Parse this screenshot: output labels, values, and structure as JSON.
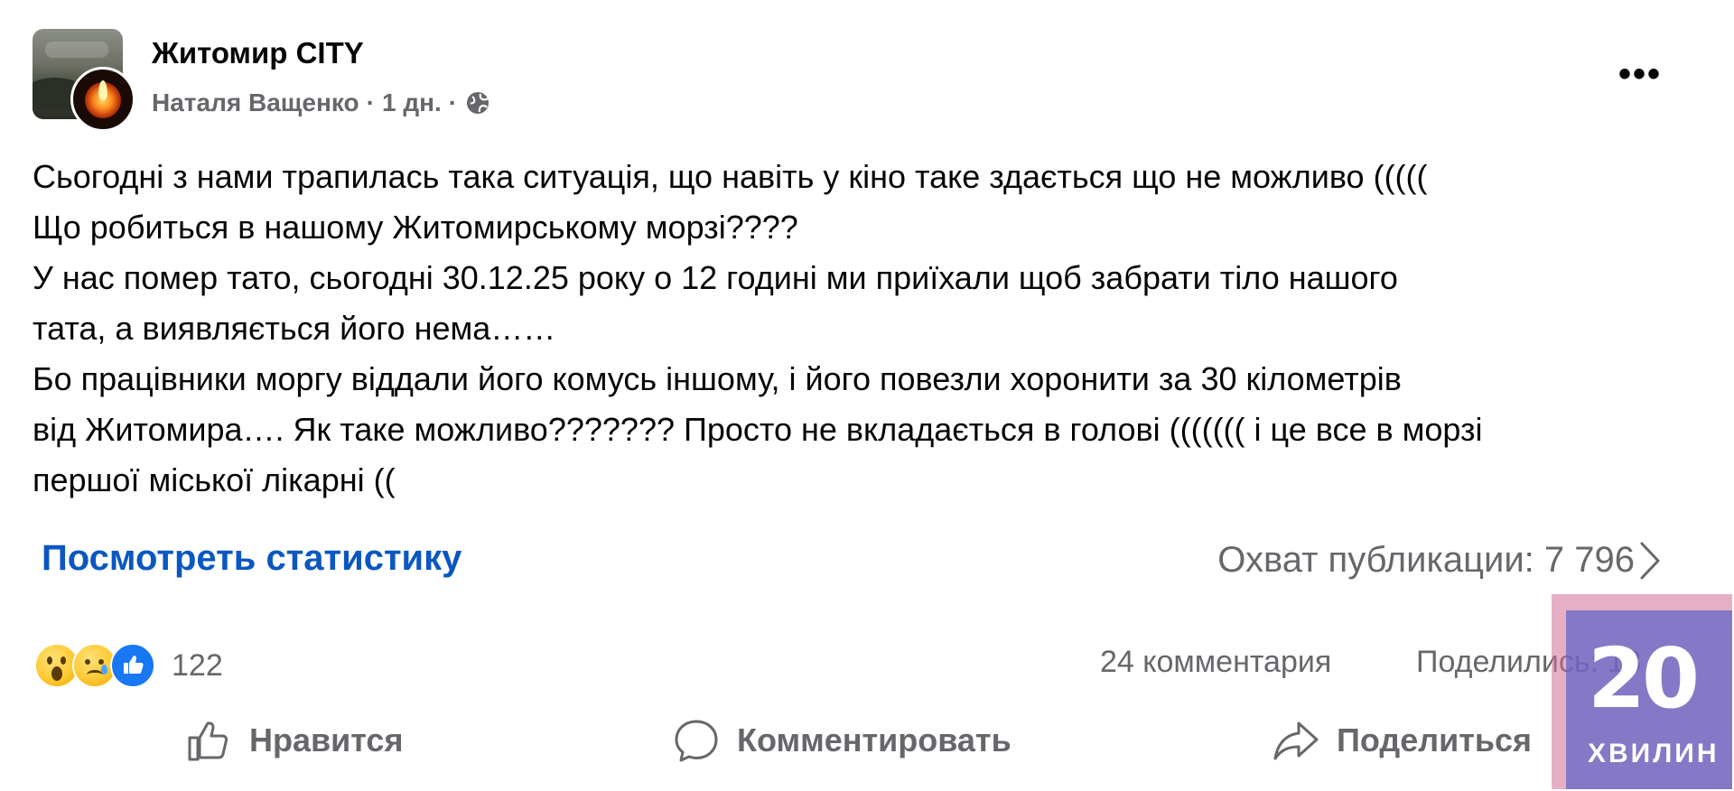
{
  "post": {
    "page_name": "Житомир CITY",
    "author": "Наталя Ващенко",
    "separator": "·",
    "time": "1 дн.",
    "more_label": "•••",
    "text_lines": [
      "Сьогодні з нами трапилась така ситуація, що навіть у кіно таке здається що не можливо (((((",
      "Що робиться в нашому Житомирському морзі????",
      "У нас помер тато, сьогодні 30.12.25 року о 12 годині ми приїхали щоб забрати тіло нашого",
      "тата, а виявляється його нема……",
      "Бо працівники моргу віддали його комусь іншому, і його повезли хоронити за 30 кілометрів",
      "від Житомира…. Як таке можливо??????? Просто не вкладається в голові ((((((( і це все в морзі",
      "першої міської лікарні (("
    ]
  },
  "stats": {
    "view_stats_label": "Посмотреть статистику",
    "reach_label": "Охват публикации: 7 796"
  },
  "engagement": {
    "reactions": [
      "wow",
      "sad",
      "like"
    ],
    "reaction_count": "122",
    "comments": "24 комментария",
    "shares": "Поделились: 18"
  },
  "actions": {
    "like": "Нравится",
    "comment": "Комментировать",
    "share": "Поделиться"
  },
  "watermark": {
    "number": "20",
    "word": "ХВИЛИН"
  },
  "colors": {
    "link": "#0a57c2",
    "secondary_text": "#65676b",
    "like_blue": "#1877f2"
  }
}
